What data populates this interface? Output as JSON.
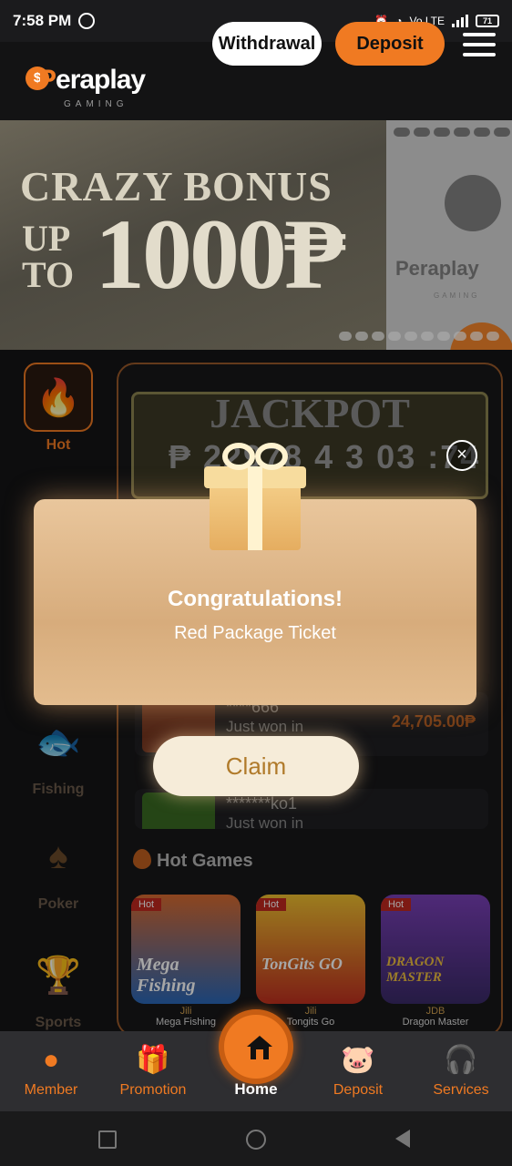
{
  "status_bar": {
    "time": "7:58 PM",
    "network": "Vo LTE",
    "battery": "71"
  },
  "header": {
    "brand_p": "P",
    "brand_rest": "eraplay",
    "brand_sub": "GAMING",
    "coin_symbol": "$",
    "withdrawal_label": "Withdrawal",
    "deposit_label": "Deposit"
  },
  "banner": {
    "line1": "CRAZY BONUS",
    "up": "UP",
    "to": "TO",
    "amount": "1000₱",
    "side_logo": "Peraplay",
    "side_logo_sub": "GAMING"
  },
  "sidebar": {
    "hot": "Hot",
    "fishing": "Fishing",
    "poker": "Poker",
    "sports": "Sports"
  },
  "jackpot": {
    "title": "JACKPOT",
    "value": "₱ 22978 4 3 03 :74"
  },
  "winners": [
    {
      "user": "****666",
      "text": "Just won in",
      "amount": "24,705.00₱"
    },
    {
      "user": "*******ko1",
      "text": "Just won in",
      "amount": ""
    }
  ],
  "hot_games": {
    "title": "Hot Games",
    "tag": "Hot",
    "items": [
      {
        "art_title": "Mega Fishing",
        "provider": "Jili",
        "name": "Mega Fishing"
      },
      {
        "art_title": "TonGits GO",
        "provider": "Jili",
        "name": "Tongits Go"
      },
      {
        "art_title": "DRAGON MASTER",
        "provider": "JDB",
        "name": "Dragon Master"
      }
    ]
  },
  "popup": {
    "congrats": "Congratulations!",
    "subtitle": "Red Package Ticket",
    "claim_label": "Claim",
    "close_symbol": "×"
  },
  "bottom_nav": {
    "member": "Member",
    "promotion": "Promotion",
    "home": "Home",
    "deposit": "Deposit",
    "services": "Services"
  },
  "colors": {
    "accent": "#f07a22",
    "popup": "#e3bc8e",
    "claim_text": "#b07a2a"
  }
}
